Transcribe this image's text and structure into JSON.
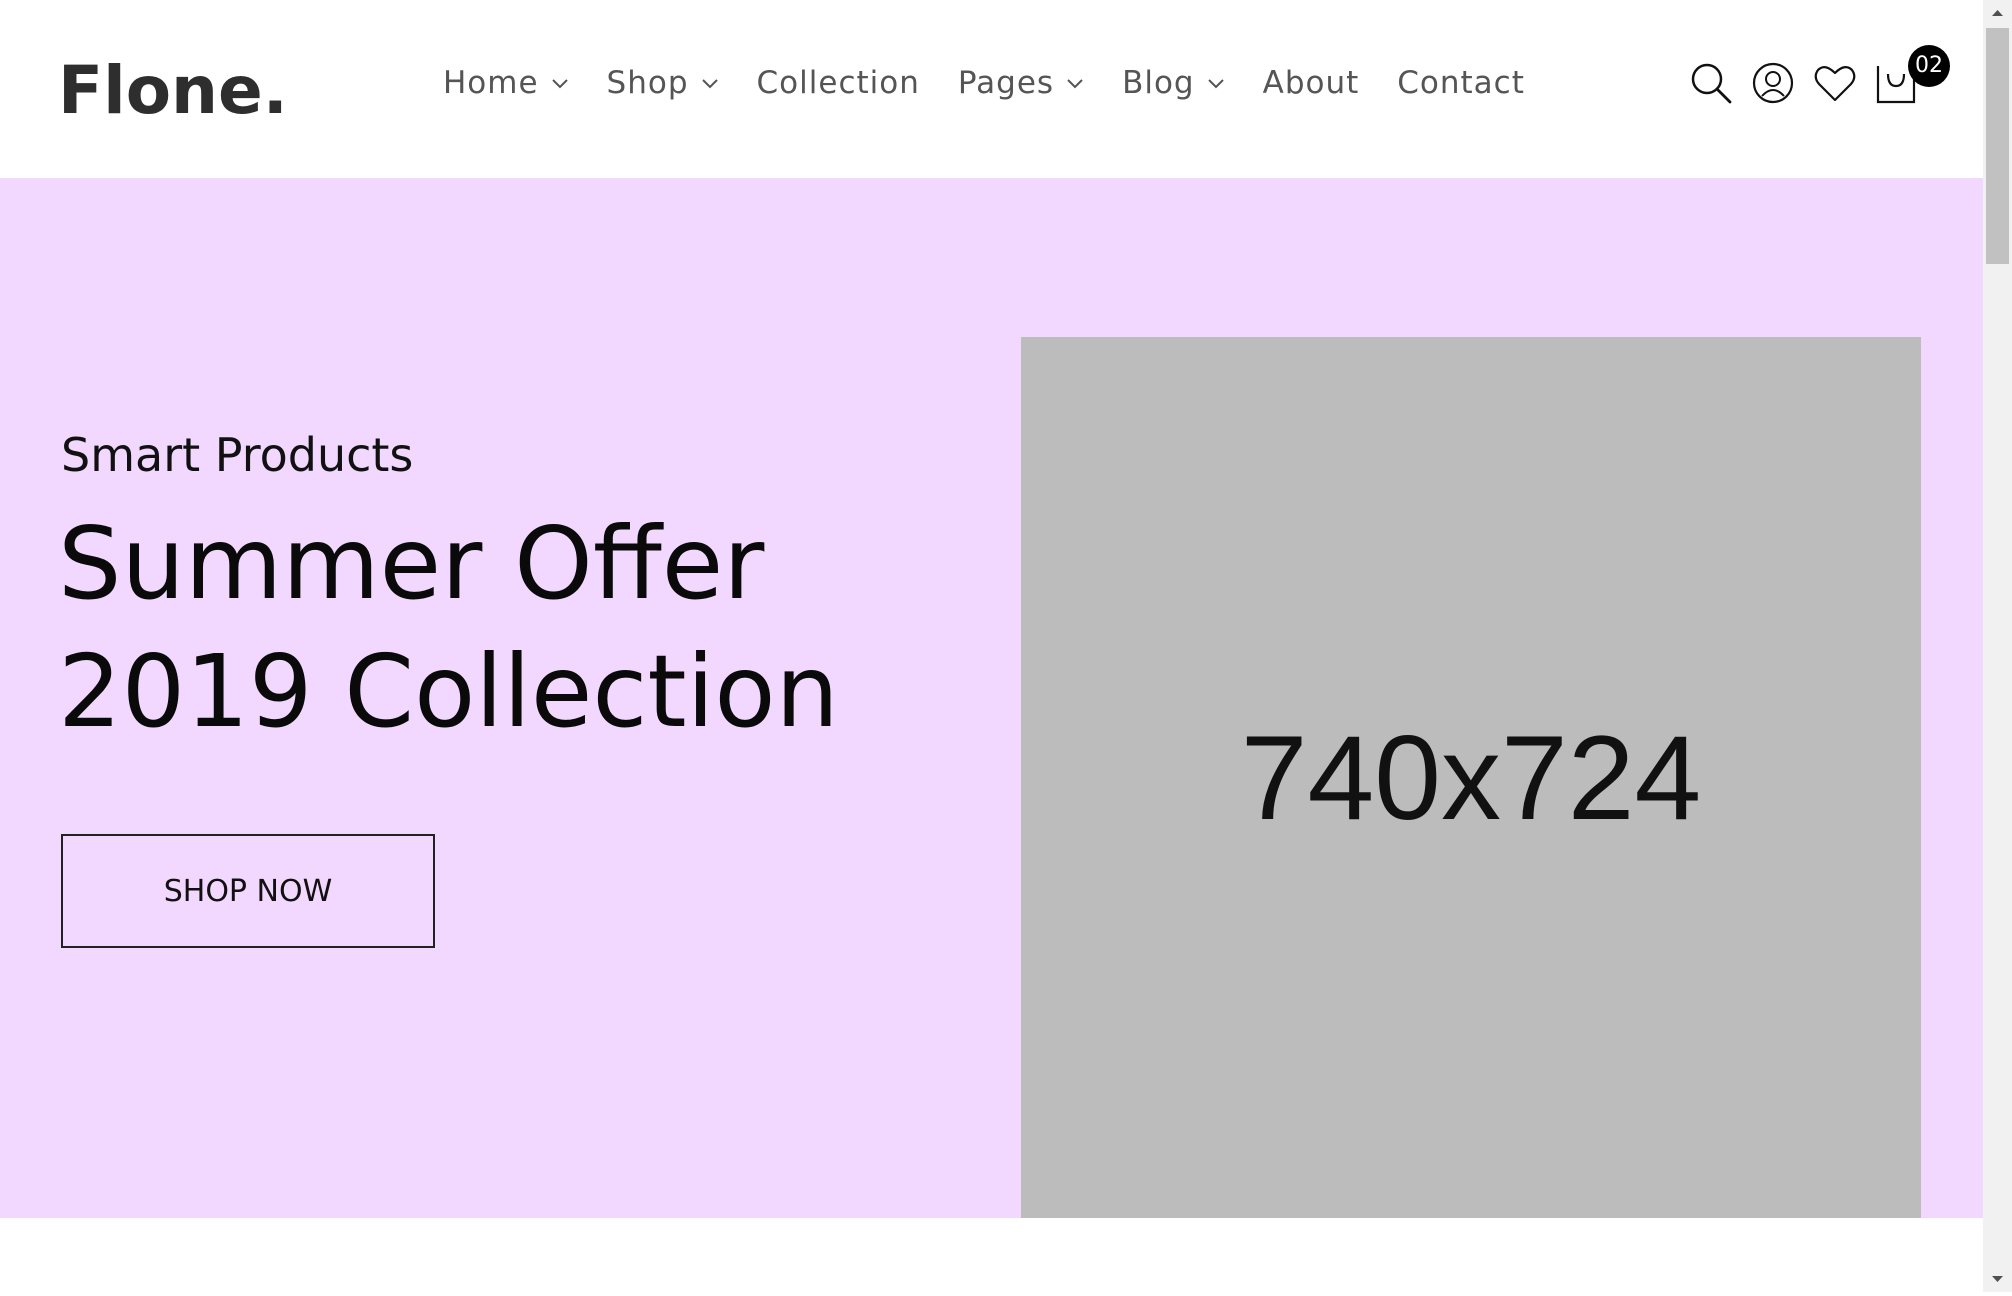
{
  "header": {
    "logo": "Flone.",
    "nav": [
      {
        "label": "Home",
        "has_dropdown": true
      },
      {
        "label": "Shop",
        "has_dropdown": true
      },
      {
        "label": "Collection",
        "has_dropdown": false
      },
      {
        "label": "Pages",
        "has_dropdown": true
      },
      {
        "label": "Blog",
        "has_dropdown": true
      },
      {
        "label": "About",
        "has_dropdown": false
      },
      {
        "label": "Contact",
        "has_dropdown": false
      }
    ],
    "icons": [
      "search-icon",
      "user-icon",
      "heart-icon",
      "cart-icon"
    ],
    "cart_count": "02"
  },
  "hero": {
    "subtitle": "Smart Products",
    "title_line1": "Summer Offer",
    "title_line2": "2019 Collection",
    "button_label": "SHOP NOW",
    "image_placeholder": "740x724",
    "background_color": "#f2d8fe",
    "image_color": "#bcbcbc"
  }
}
